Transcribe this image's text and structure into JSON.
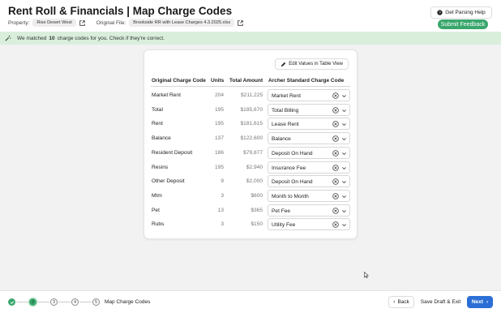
{
  "header": {
    "title": "Rent Roll & Financials | Map Charge Codes",
    "property_label": "Property:",
    "property_value": "Rise Desert West",
    "file_label": "Original File:",
    "file_value": "Brookside RR with Lease Charges 4.3.2025.xlsx",
    "help_label": "Get Parsing Help",
    "submit_label": "Submit Feedback"
  },
  "banner": {
    "prefix": "We matched",
    "count": "10",
    "suffix": "charge codes for you. Check if they're correct."
  },
  "card": {
    "edit_label": "Edit Values in Table View",
    "columns": {
      "code": "Original Charge Code",
      "units": "Units",
      "amount": "Total Amount",
      "standard": "Archer Standard Charge Code"
    },
    "rows": [
      {
        "code": "Market Rent",
        "units": "204",
        "amount": "$211,225",
        "standard": "Market Rent"
      },
      {
        "code": "Total",
        "units": "195",
        "amount": "$185,670",
        "standard": "Total Billing"
      },
      {
        "code": "Rent",
        "units": "195",
        "amount": "$181,615",
        "standard": "Lease Rent"
      },
      {
        "code": "Balance",
        "units": "137",
        "amount": "$122,600",
        "standard": "Balance"
      },
      {
        "code": "Resident Deposit",
        "units": "186",
        "amount": "$79,877",
        "standard": "Deposit On Hand"
      },
      {
        "code": "Resins",
        "units": "195",
        "amount": "$2,940",
        "standard": "Insurance Fee"
      },
      {
        "code": "Other Deposit",
        "units": "9",
        "amount": "$2,000",
        "standard": "Deposit On Hand"
      },
      {
        "code": "Mtm",
        "units": "3",
        "amount": "$600",
        "standard": "Month to Month"
      },
      {
        "code": "Pet",
        "units": "13",
        "amount": "$365",
        "standard": "Pet Fee"
      },
      {
        "code": "Rubs",
        "units": "3",
        "amount": "$150",
        "standard": "Utility Fee"
      }
    ]
  },
  "footer": {
    "steps": [
      "2",
      "3",
      "4",
      "5"
    ],
    "current_step_label": "Map Charge Codes",
    "back_label": "Back",
    "draft_label": "Save Draft & Exit",
    "next_label": "Next"
  },
  "colors": {
    "accent_green": "#3aa76d",
    "banner_green": "#d9efdc",
    "primary_blue": "#2b6fd6"
  },
  "icons": [
    "external-link-icon",
    "help-circle-icon",
    "magic-wand-icon",
    "pencil-icon",
    "clear-circle-icon",
    "chevron-down-icon",
    "check-icon",
    "chevron-left-icon",
    "chevron-right-icon"
  ]
}
